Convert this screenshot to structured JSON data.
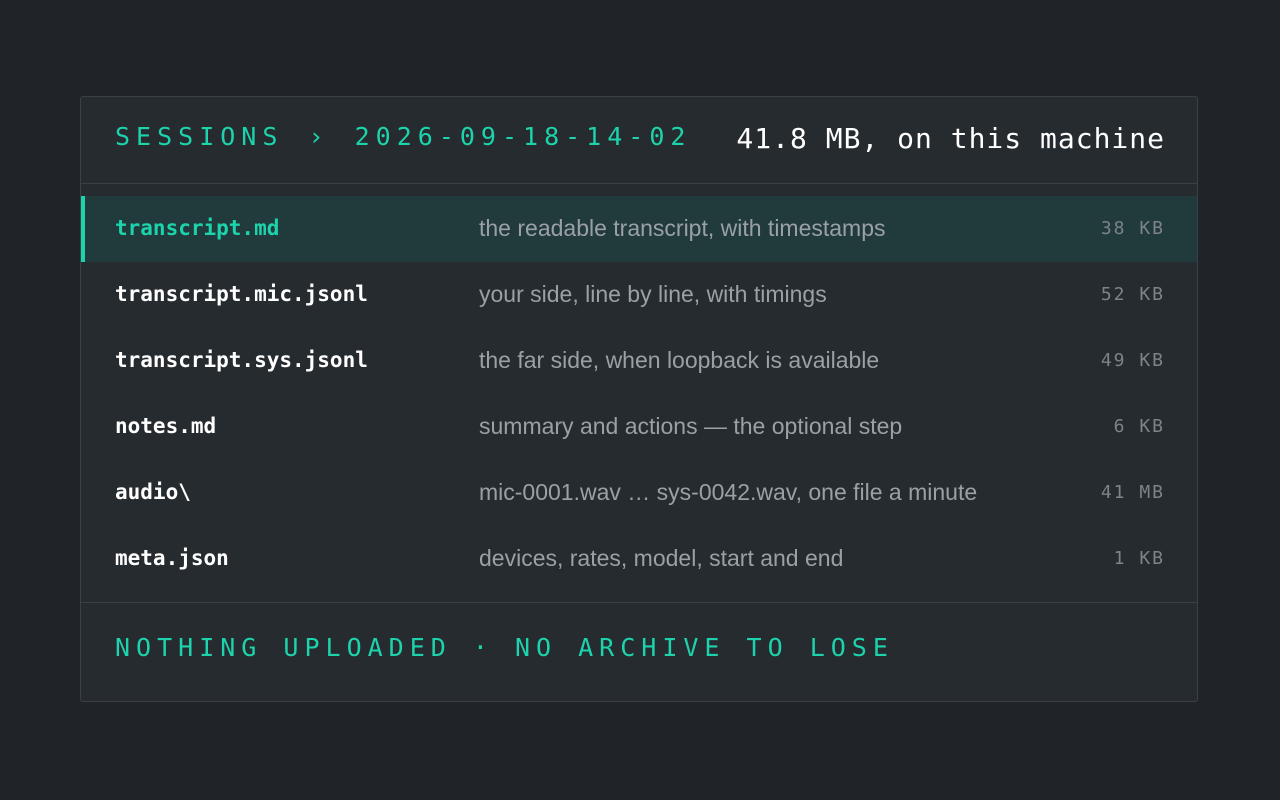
{
  "header": {
    "crumb_root": "SESSIONS",
    "crumb_separator": "›",
    "crumb_current": "2026-09-18-14-02",
    "total_size": "41.8 MB, on this machine"
  },
  "files": [
    {
      "name": "transcript.md",
      "description": "the readable transcript, with timestamps",
      "size": "38 KB",
      "selected": true
    },
    {
      "name": "transcript.mic.jsonl",
      "description": "your side, line by line, with timings",
      "size": "52 KB",
      "selected": false
    },
    {
      "name": "transcript.sys.jsonl",
      "description": "the far side, when loopback is available",
      "size": "49 KB",
      "selected": false
    },
    {
      "name": "notes.md",
      "description": "summary and actions — the optional step",
      "size": "6 KB",
      "selected": false
    },
    {
      "name": "audio\\",
      "description": "mic-0001.wav … sys-0042.wav, one file a minute",
      "size": "41 MB",
      "selected": false
    },
    {
      "name": "meta.json",
      "description": "devices, rates, model, start and end",
      "size": "1 KB",
      "selected": false
    }
  ],
  "footer": {
    "status": "NOTHING UPLOADED · NO ARCHIVE TO LOSE"
  },
  "colors": {
    "background": "#202428",
    "panel": "#262b30",
    "accent": "#1dd3ac",
    "selected_row": "#213a3c",
    "text": "#ffffff",
    "muted": "#9aa0a6"
  }
}
